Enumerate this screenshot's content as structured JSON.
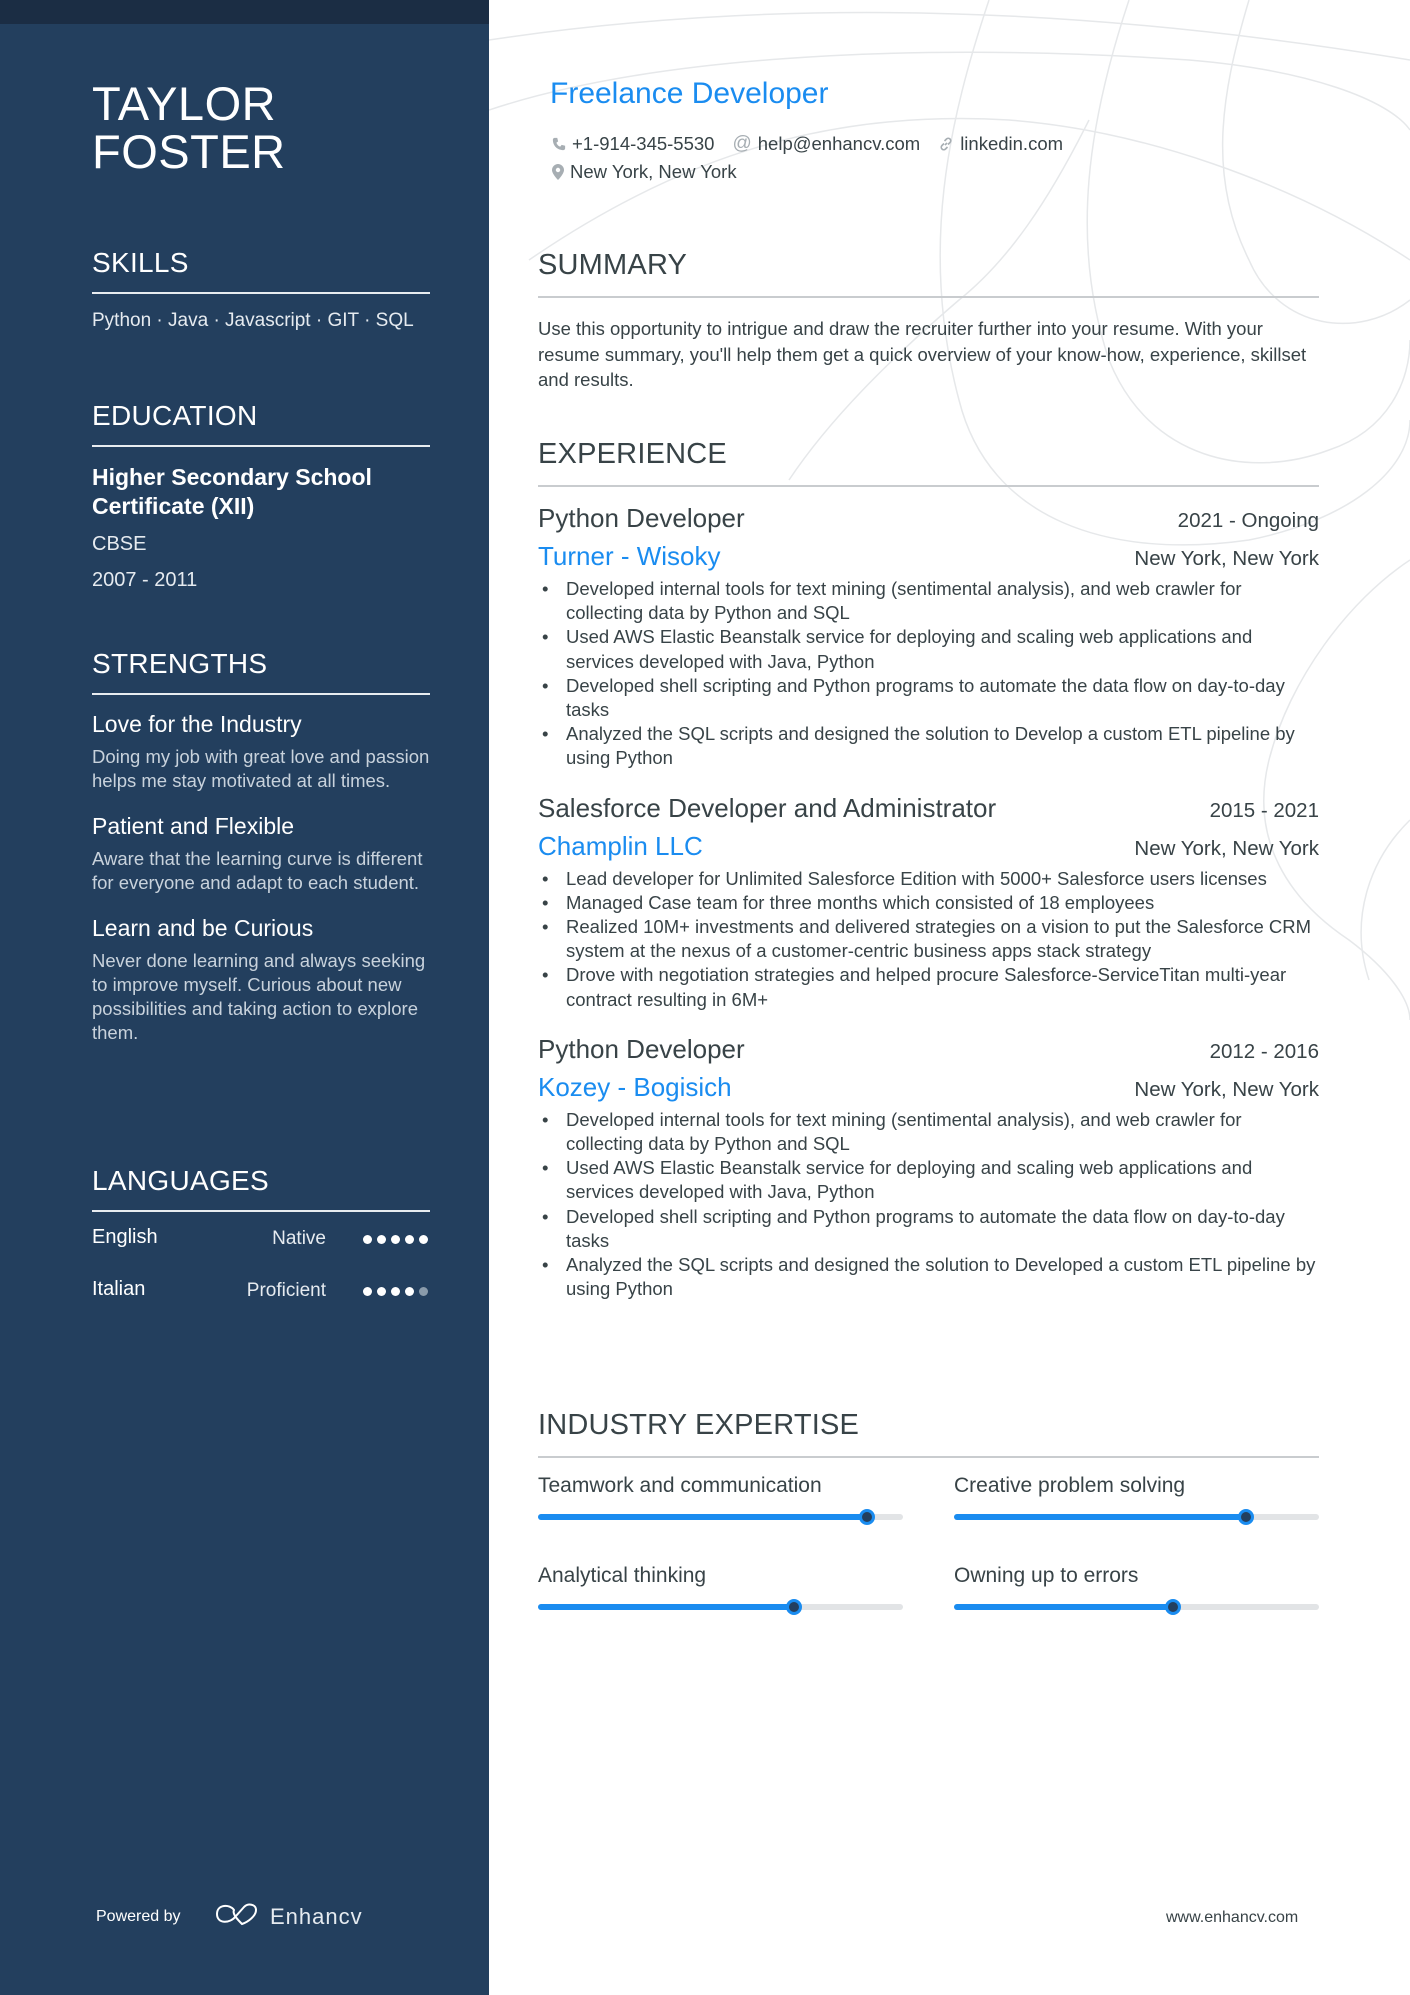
{
  "header": {
    "name_line1": "TAYLOR",
    "name_line2": "FOSTER",
    "role": "Freelance Developer",
    "contact": {
      "phone": "+1-914-345-5530",
      "email": "help@enhancv.com",
      "link": "linkedin.com",
      "location": "New York, New York"
    },
    "icons": {
      "phone": "phone-icon",
      "email": "at-icon",
      "link": "link-icon",
      "location": "map-pin-icon"
    }
  },
  "sidebar": {
    "skills": {
      "title": "SKILLS",
      "text": "Python · Java · Javascript · GIT · SQL"
    },
    "education": {
      "title": "EDUCATION",
      "degree": "Higher Secondary School Certificate (XII)",
      "institution": "CBSE",
      "dates": "2007 - 2011"
    },
    "strengths": {
      "title": "STRENGTHS",
      "items": [
        {
          "title": "Love for the Industry",
          "desc": "Doing my job with great love and passion helps me stay motivated at all times."
        },
        {
          "title": "Patient and Flexible",
          "desc": "Aware that the learning curve is different for everyone and adapt to each student."
        },
        {
          "title": "Learn and be Curious",
          "desc": "Never done learning and always seeking to improve myself. Curious about new possibilities and taking action to explore them."
        }
      ]
    },
    "languages": {
      "title": "LANGUAGES",
      "items": [
        {
          "name": "English",
          "level": "Native",
          "rating": 5,
          "max": 5
        },
        {
          "name": "Italian",
          "level": "Proficient",
          "rating": 4,
          "max": 5
        }
      ]
    },
    "footer": {
      "powered_by": "Powered by",
      "brand": "Enhancv"
    }
  },
  "summary": {
    "title": "SUMMARY",
    "text": "Use this opportunity to intrigue and draw the recruiter further into your resume. With your resume summary, you'll help them get a quick overview of your know-how, experience, skillset and results."
  },
  "experience": {
    "title": "EXPERIENCE",
    "jobs": [
      {
        "title": "Python Developer",
        "dates": "2021 - Ongoing",
        "company": "Turner - Wisoky",
        "location": "New York, New York",
        "bullets": [
          "Developed internal tools for text mining (sentimental analysis), and web crawler for collecting data by Python and SQL",
          "Used AWS Elastic Beanstalk service for deploying and scaling web applications and services developed with Java, Python",
          "Developed shell scripting and Python programs to automate the data flow on day-to-day tasks",
          "Analyzed the SQL scripts and designed the solution to Develop a custom ETL pipeline by using Python"
        ]
      },
      {
        "title": "Salesforce Developer and Administrator",
        "dates": "2015 - 2021",
        "company": "Champlin LLC",
        "location": "New York, New York",
        "bullets": [
          "Lead developer for Unlimited Salesforce Edition with 5000+ Salesforce users licenses",
          "Managed Case team for three months which consisted of 18 employees",
          "Realized 10M+ investments and delivered strategies on a vision to put the Salesforce CRM system at the nexus of a customer-centric business apps stack strategy",
          "Drove with negotiation strategies and helped procure Salesforce-ServiceTitan multi-year contract resulting in 6M+"
        ]
      },
      {
        "title": "Python Developer",
        "dates": "2012 - 2016",
        "company": "Kozey - Bogisich",
        "location": "New York, New York",
        "bullets": [
          "Developed internal tools for text mining (sentimental analysis), and web crawler for collecting data by Python and SQL",
          "Used AWS Elastic Beanstalk service for deploying and scaling web applications and services developed with Java, Python",
          "Developed shell scripting and Python programs to automate the data flow on day-to-day tasks",
          "Analyzed the SQL scripts and designed the solution to Developed a custom ETL pipeline by using Python"
        ]
      }
    ]
  },
  "expertise": {
    "title": "INDUSTRY EXPERTISE",
    "items": [
      {
        "label": "Teamwork and communication",
        "level": 0.9
      },
      {
        "label": "Creative problem solving",
        "level": 0.8
      },
      {
        "label": "Analytical thinking",
        "level": 0.7
      },
      {
        "label": "Owning up to errors",
        "level": 0.6
      }
    ]
  },
  "footer": {
    "website": "www.enhancv.com"
  },
  "colors": {
    "sidebar": "#233f5e",
    "sidebar_top": "#1b2d44",
    "accent": "#1a8cf0",
    "text": "#384347"
  }
}
